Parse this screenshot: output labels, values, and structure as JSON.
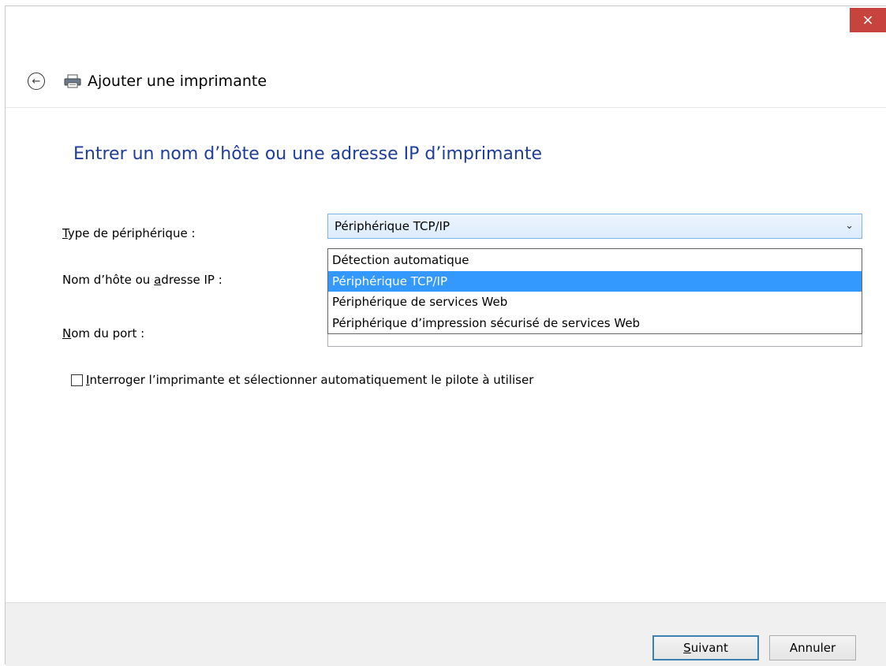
{
  "window": {
    "close_glyph": "×"
  },
  "nav": {
    "back_icon": "back-arrow-icon",
    "printer_icon": "printer-icon",
    "title": "Ajouter une imprimante"
  },
  "page": {
    "title": "Entrer un nom d’hôte ou une adresse IP d’imprimante"
  },
  "form": {
    "device_type_label_pre": "",
    "device_type_label_ul": "T",
    "device_type_label_post": "ype de périphérique :",
    "hostname_label_pre": "Nom d’hôte ou ",
    "hostname_label_ul": "a",
    "hostname_label_post": "dresse IP :",
    "port_label_pre": "",
    "port_label_ul": "N",
    "port_label_post": "om du port :",
    "device_type_value": "Périphérique TCP/IP",
    "hostname_value": "",
    "port_value": "",
    "dropdown_options": [
      "Détection automatique",
      "Périphérique TCP/IP",
      "Périphérique de services Web",
      "Périphérique d’impression sécurisé de services Web"
    ],
    "dropdown_selected_index": 1,
    "checkbox_label_ul": "I",
    "checkbox_label_post": "nterroger l’imprimante et sélectionner automatiquement le pilote à utiliser",
    "checkbox_checked": false
  },
  "footer": {
    "next_label_ul": "S",
    "next_label_post": "uivant",
    "cancel_label": "Annuler"
  },
  "colors": {
    "title_blue": "#1e3d9c",
    "close_red": "#c7433e",
    "selection_blue": "#3399ff"
  }
}
